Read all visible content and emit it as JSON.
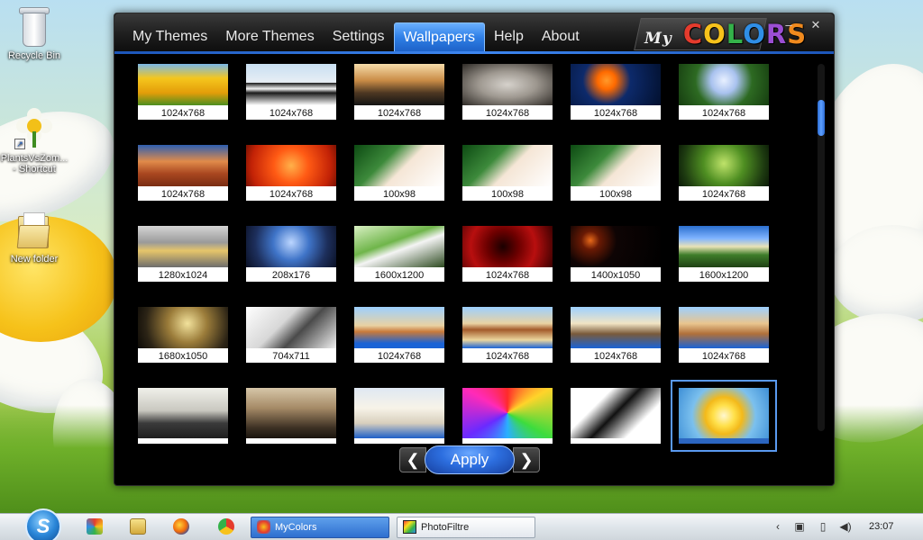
{
  "desktop": {
    "icons": [
      {
        "label": "Recycle Bin",
        "icon": "recycle-bin-icon"
      },
      {
        "label": "PlantsVsZom...\n- Shortcut",
        "icon": "plants-vs-zombies-icon"
      },
      {
        "label": "New folder",
        "icon": "folder-icon"
      }
    ]
  },
  "window": {
    "tabs": [
      {
        "label": "My Themes",
        "active": false
      },
      {
        "label": "More Themes",
        "active": false
      },
      {
        "label": "Settings",
        "active": false
      },
      {
        "label": "Wallpapers",
        "active": true
      },
      {
        "label": "Help",
        "active": false
      },
      {
        "label": "About",
        "active": false
      }
    ],
    "logo": {
      "my": "My",
      "letters": [
        "C",
        "O",
        "L",
        "O",
        "R",
        "S"
      ],
      "colors": [
        "#e53b2d",
        "#f7c21b",
        "#34b24a",
        "#2f8ee6",
        "#9b4ed3",
        "#f08a1e"
      ]
    },
    "minimize_label": "–",
    "close_label": "✕",
    "accent_color": "#2f7fe6",
    "apply_label": "Apply",
    "prev_label": "❮",
    "next_label": "❯"
  },
  "wallpapers": [
    {
      "size": "1024x768",
      "bg": "linear-gradient(180deg,#7ab8e8 0%,#f5c61d 35%,#e39d09 70%,#4b8f20 100%)"
    },
    {
      "size": "1024x768",
      "bg": "linear-gradient(180deg,#c8dff2 0%,#e8eef4 45%,#1b1b1b 46%,#f4f4f4 60%,#1b1b1b 70%,#ffffff 100%)"
    },
    {
      "size": "1024x768",
      "bg": "linear-gradient(180deg,#f6dcaa 0%,#c98c46 40%,#4d3722 70%,#141414 100%)"
    },
    {
      "size": "1024x768",
      "bg": "radial-gradient(ellipse at 50% 50%,#d6d2cc 0%,#9e9890 45%,#2e2a26 100%)"
    },
    {
      "size": "1024x768",
      "bg": "radial-gradient(circle at 40% 40%,#ff9a2a 0%,#ff6a00 15%,#0d2a6b 40%,#02102e 100%)"
    },
    {
      "size": "1024x768",
      "bg": "radial-gradient(circle at 50% 40%,#e8f0ff 0%,#a9c2ef 25%,#2d6a22 55%,#163d10 100%)"
    },
    {
      "size": "1024x768",
      "bg": "linear-gradient(180deg,#2e5fb0 0%,#e08b4a 40%,#a8461f 70%,#7a2d13 100%)"
    },
    {
      "size": "1024x768",
      "bg": "radial-gradient(circle at 50% 50%,#ffb14a 0%,#ff5a14 35%,#c22206 80%,#7a1202 100%)"
    },
    {
      "size": "100x98",
      "bg": "linear-gradient(135deg,#0c4a12 0%,#3d8a3b 35%,#f5e6d6 55%,#ffffff 100%)"
    },
    {
      "size": "100x98",
      "bg": "linear-gradient(135deg,#0c4a12 0%,#3d8a3b 35%,#f5e6d6 55%,#ffffff 100%)"
    },
    {
      "size": "100x98",
      "bg": "linear-gradient(135deg,#0c4a12 0%,#3d8a3b 35%,#f5e6d6 55%,#ffffff 100%)"
    },
    {
      "size": "1024x768",
      "bg": "radial-gradient(circle at 50% 45%,#bfe36a 0%,#4f8f22 40%,#1d3a10 80%,#0b1a06 100%)"
    },
    {
      "size": "1280x1024",
      "bg": "linear-gradient(180deg,#d5d5d5 0%,#9a9a9a 40%,#e6c56a 60%,#6d6d6d 100%)"
    },
    {
      "size": "208x176",
      "bg": "radial-gradient(circle at 50% 40%,#bcd6ff 0%,#3f74c8 35%,#1d2f5c 70%,#0a1024 100%)"
    },
    {
      "size": "1600x1200",
      "bg": "linear-gradient(160deg,#d9f0c3 0%,#6fb54a 40%,#f4f4f4 55%,#2d4a20 100%)"
    },
    {
      "size": "1024x768",
      "bg": "radial-gradient(circle at 45% 50%,#1a0000 0%,#6d0000 30%,#b80f0f 60%,#3b0000 100%)"
    },
    {
      "size": "1400x1050",
      "bg": "radial-gradient(circle at 22% 35%,#e86a1a 0%,#6a1a04 12%,#0e0404 35%,#000000 100%)"
    },
    {
      "size": "1600x1200",
      "bg": "linear-gradient(180deg,#2b6fcf 0%,#7fb3ff 30%,#e9e2b6 50%,#3e7d2a 70%,#1f4114 100%)"
    },
    {
      "size": "1680x1050",
      "bg": "radial-gradient(circle at 55% 40%,#f2e29c 0%,#9b7c3a 35%,#2c2416 75%,#0c0a06 100%)"
    },
    {
      "size": "704x711",
      "bg": "linear-gradient(135deg,#ffffff 0%,#d7d7d7 40%,#4a4a4a 60%,#f0f0f0 100%)"
    },
    {
      "size": "1024x768",
      "bg": "linear-gradient(180deg,#9dd0ff 0%,#e9d2a3 45%,#c97a3a 60%,#1a63d6 88%,#1a63d6 100%)"
    },
    {
      "size": "1024x768",
      "bg": "linear-gradient(180deg,#9dd0ff 0%,#e9d2a3 40%,#a35a2a 55%,#ecd69e 80%,#1a63d6 100%)"
    },
    {
      "size": "1024x768",
      "bg": "linear-gradient(180deg,#9dd0ff 0%,#f1e4c4 40%,#7a5a3a 65%,#1a63d6 100%)"
    },
    {
      "size": "1024x768",
      "bg": "linear-gradient(180deg,#9dd0ff 0%,#e9c58f 40%,#b0703a 65%,#1a63d6 100%)"
    },
    {
      "size": "",
      "bg": "linear-gradient(180deg,#f0f0ea 0%,#c9c8c0 45%,#3b3b3b 70%,#1e1e1e 100%)"
    },
    {
      "size": "",
      "bg": "linear-gradient(180deg,#d6c6a8 0%,#a58a66 40%,#3b2f22 80%,#1a140e 100%)"
    },
    {
      "size": "",
      "bg": "linear-gradient(180deg,#dfe8f3 0%,#f7f3e8 40%,#d8cfbd 70%,#1d5fc8 100%)"
    },
    {
      "size": "",
      "bg": "conic-gradient(from 0deg,#ff2a2a,#ffd42a,#3ddc3d,#2ab0ff,#6a2aff,#ff2ab8,#ff2a2a)"
    },
    {
      "size": "",
      "bg": "linear-gradient(135deg,#ffffff 0%,#ffffff 30%,#111111 50%,#ffffff 75%,#ffffff 100%)"
    },
    {
      "size": "",
      "bg": "radial-gradient(circle at 50% 55%,#fff7d0 0%,#ffe04a 20%,#f3b91a 35%,#7bc0ee 60%,#3e8fd6 100%)"
    }
  ],
  "selected_index": 29,
  "taskbar": {
    "tasks": [
      {
        "label": "MyColors",
        "active": true,
        "icon": "mycolors-app-icon"
      },
      {
        "label": "PhotoFiltre",
        "active": false,
        "icon": "photofiltre-app-icon"
      }
    ],
    "pinned": [
      "picasa-icon",
      "explorer-icon",
      "firefox-icon",
      "chrome-icon"
    ],
    "tray": [
      {
        "icon": "show-hidden-icons-icon",
        "glyph": "‹"
      },
      {
        "icon": "network-icon",
        "glyph": "▣"
      },
      {
        "icon": "battery-icon",
        "glyph": "▯"
      },
      {
        "icon": "volume-icon",
        "glyph": "◀)"
      }
    ],
    "clock": "23:07"
  }
}
